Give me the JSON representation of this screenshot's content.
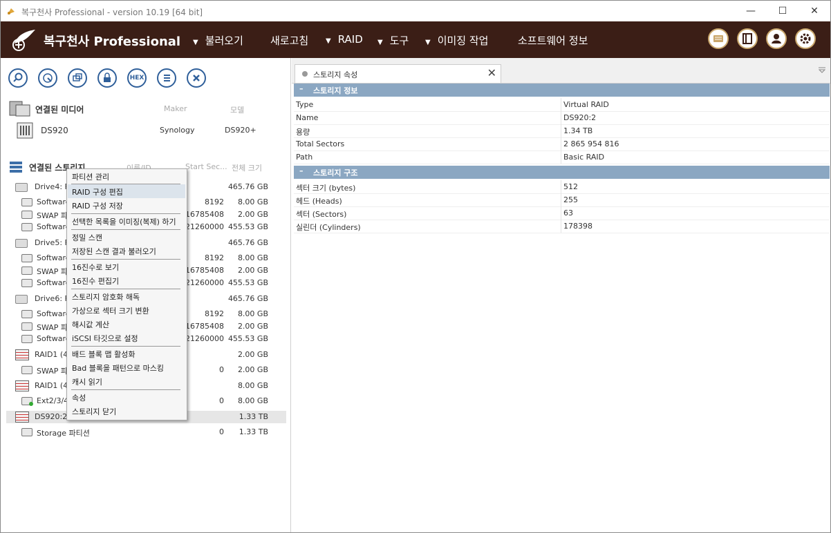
{
  "window": {
    "title": "복구천사 Professional - version 10.19 [64 bit]",
    "minimize": "—",
    "maximize": "☐",
    "close": "✕"
  },
  "menubar": {
    "brand": "복구천사 Professional",
    "items": [
      {
        "label": "불러오기",
        "dropdown": true
      },
      {
        "label": "새로고침",
        "dropdown": false
      },
      {
        "label": "RAID",
        "dropdown": true
      },
      {
        "label": "도구",
        "dropdown": true
      },
      {
        "label": "이미징 작업",
        "dropdown": true
      },
      {
        "label": "소프트웨어 정보",
        "dropdown": false
      }
    ],
    "tri": "▼"
  },
  "toolbar": {
    "hex_label": "HEX"
  },
  "media": {
    "header": "연결된 미디어",
    "col_maker": "Maker",
    "col_model": "모델",
    "device_name": "DS920",
    "device_maker": "Synology",
    "device_model": "DS920+"
  },
  "storage": {
    "header": "연결된 스토리지",
    "col_name": "이름/ID",
    "col_start": "Start Sec...",
    "col_size": "전체 크기",
    "rows": [
      {
        "name": "Drive4: Fi",
        "start": "",
        "size": "465.76 GB"
      },
      {
        "name": "Software",
        "start": "8192",
        "size": "8.00 GB"
      },
      {
        "name": "SWAP 파",
        "start": "16785408",
        "size": "2.00 GB"
      },
      {
        "name": "Software",
        "start": "21260000",
        "size": "455.53 GB"
      },
      {
        "name": "Drive5: Fi",
        "start": "",
        "size": "465.76 GB"
      },
      {
        "name": "Software",
        "start": "8192",
        "size": "8.00 GB"
      },
      {
        "name": "SWAP 파",
        "start": "16785408",
        "size": "2.00 GB"
      },
      {
        "name": "Software",
        "start": "21260000",
        "size": "455.53 GB"
      },
      {
        "name": "Drive6: Fi",
        "start": "",
        "size": "465.76 GB"
      },
      {
        "name": "Software",
        "start": "8192",
        "size": "8.00 GB"
      },
      {
        "name": "SWAP 파",
        "start": "16785408",
        "size": "2.00 GB"
      },
      {
        "name": "Software",
        "start": "21260000",
        "size": "455.53 GB"
      },
      {
        "name": "RAID1 (4",
        "start": "",
        "size": "2.00 GB"
      },
      {
        "name": "SWAP 파",
        "start": "0",
        "size": "2.00 GB"
      },
      {
        "name": "RAID1 (4",
        "start": "",
        "size": "8.00 GB"
      },
      {
        "name": "Ext2/3/4",
        "start": "0",
        "size": "8.00 GB"
      },
      {
        "name": "DS920:2",
        "start": "",
        "size": "1.33 TB"
      },
      {
        "name": "Storage 파티션",
        "start": "0",
        "size": "1.33 TB"
      }
    ]
  },
  "context_menu": [
    "파티션 관리",
    "RAID 구성 편집",
    "RAID 구성 저장",
    "선택한 목록을 이미징(복제) 하기",
    "정밀 스캔",
    "저장된 스캔 결과 불러오기",
    "16진수로 보기",
    "16진수 편집기",
    "스토리지 암호화 해독",
    "가상으로 섹터 크기 변환",
    "해시값 계산",
    "iSCSI 타깃으로 설정",
    "배드 블록 맵 활성화",
    "Bad 블록을 패턴으로 마스킹",
    "캐시 읽기",
    "속성",
    "스토리지 닫기"
  ],
  "right": {
    "tab_label": "스토리지 속성",
    "tab_close": "✕",
    "collapse_sign": "–",
    "section1": "스토리지 정보",
    "info": [
      {
        "k": "Type",
        "v": "Virtual RAID"
      },
      {
        "k": "Name",
        "v": "DS920:2"
      },
      {
        "k": "용량",
        "v": "1.34 TB"
      },
      {
        "k": "Total Sectors",
        "v": "2 865 954 816"
      },
      {
        "k": "Path",
        "v": "Basic RAID"
      }
    ],
    "section2": "스토리지 구조",
    "structure": [
      {
        "k": "섹터 크기 (bytes)",
        "v": "512"
      },
      {
        "k": "헤드 (Heads)",
        "v": "255"
      },
      {
        "k": "섹터 (Sectors)",
        "v": "63"
      },
      {
        "k": "실린더 (Cylinders)",
        "v": "178398"
      }
    ]
  },
  "colors": {
    "menubar_bg": "#3b1e16",
    "section_bg": "#8ba7c2",
    "tool_accent": "#2f5f9a",
    "highlight": "#dce4ec"
  }
}
